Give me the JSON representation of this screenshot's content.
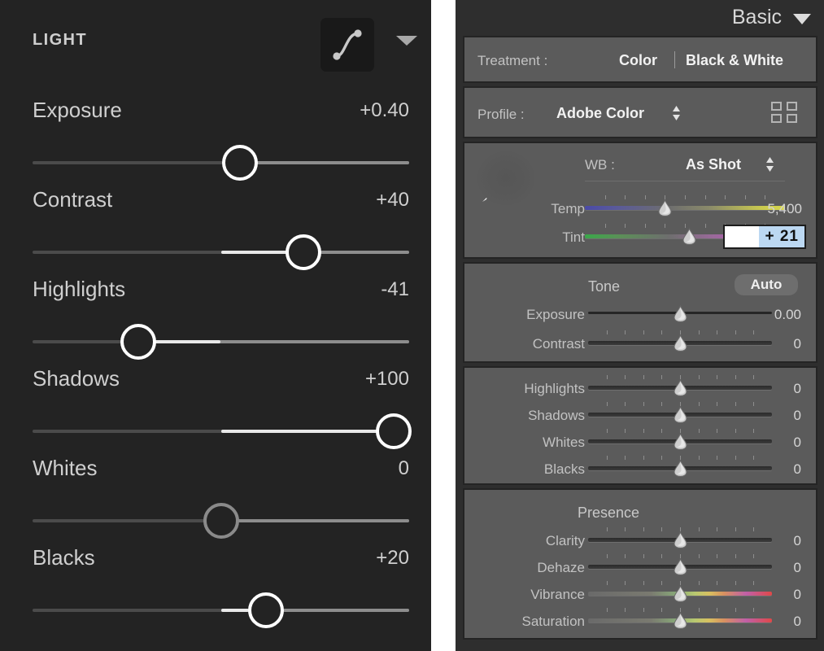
{
  "left_panel": {
    "title": "LIGHT",
    "curve_icon": "tone-curve-icon",
    "expand_icon": "chevron-down-icon",
    "sliders": [
      {
        "label": "Exposure",
        "value": "+0.40",
        "pos": 55.0,
        "num": 0.4,
        "zero": false
      },
      {
        "label": "Contrast",
        "value": "+40",
        "pos": 72.0,
        "num": 40,
        "zero": false
      },
      {
        "label": "Highlights",
        "value": "-41",
        "pos": 28.0,
        "num": -41,
        "zero": false
      },
      {
        "label": "Shadows",
        "value": "+100",
        "pos": 96.0,
        "num": 100,
        "zero": false
      },
      {
        "label": "Whites",
        "value": "0",
        "pos": 50.0,
        "num": 0,
        "zero": true
      },
      {
        "label": "Blacks",
        "value": "+20",
        "pos": 62.0,
        "num": 20,
        "zero": false
      }
    ]
  },
  "right_panel": {
    "title": "Basic",
    "collapse_icon": "chevron-down-icon",
    "treatment": {
      "label": "Treatment :",
      "option_color": "Color",
      "option_bw": "Black & White",
      "selected": "Color"
    },
    "profile": {
      "label": "Profile :",
      "value": "Adobe Color",
      "stepper_icon": "up-down-stepper-icon",
      "browse_icon": "profile-grid-icon"
    },
    "whitebalance": {
      "eyedropper_icon": "eyedropper-icon",
      "label": "WB :",
      "value": "As Shot",
      "stepper_icon": "up-down-stepper-icon",
      "temp": {
        "label": "Temp",
        "value": "5,400",
        "pos": 40.0
      },
      "tint": {
        "label": "Tint",
        "value": "+ 21",
        "pos": 52.0
      }
    },
    "tone": {
      "heading": "Tone",
      "auto_label": "Auto",
      "sliders": [
        {
          "label": "Exposure",
          "value": "0.00",
          "pos": 50.0,
          "ticks": false
        },
        {
          "label": "Contrast",
          "value": "0",
          "pos": 50.0,
          "ticks": true
        }
      ]
    },
    "tone_detail": {
      "sliders": [
        {
          "label": "Highlights",
          "value": "0",
          "pos": 50.0
        },
        {
          "label": "Shadows",
          "value": "0",
          "pos": 50.0
        },
        {
          "label": "Whites",
          "value": "0",
          "pos": 50.0
        },
        {
          "label": "Blacks",
          "value": "0",
          "pos": 50.0
        }
      ]
    },
    "presence": {
      "heading": "Presence",
      "sliders": [
        {
          "label": "Clarity",
          "value": "0",
          "pos": 50.0,
          "grad": false
        },
        {
          "label": "Dehaze",
          "value": "0",
          "pos": 50.0,
          "grad": false
        },
        {
          "label": "Vibrance",
          "value": "0",
          "pos": 50.0,
          "grad": true
        },
        {
          "label": "Saturation",
          "value": "0",
          "pos": 50.0,
          "grad": true
        }
      ]
    }
  },
  "colors": {
    "left_bg": "#232323",
    "right_bg": "#2e2e2e",
    "section_bg": "#5b5b5b",
    "section_border": "#242424",
    "knob_active": "#ffffff",
    "knob_zero": "#8a8a8a",
    "fill_bright": "#e8e8e8",
    "selection_blue": "#bcd8f2",
    "temp_cold": "#4a4aa8",
    "temp_warm": "#d8d84a",
    "tint_green": "#3aa84a",
    "tint_magenta": "#cc4acc"
  }
}
